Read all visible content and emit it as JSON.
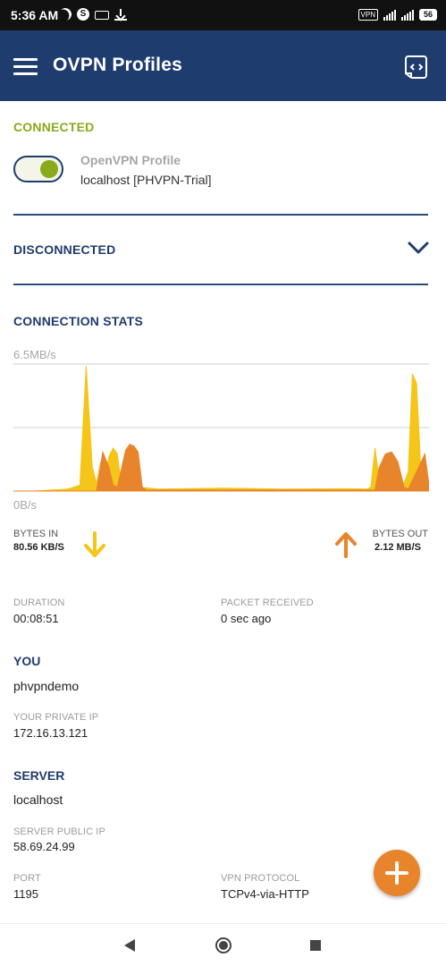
{
  "status_bar": {
    "time": "5:36 AM",
    "vpn_badge": "VPN",
    "network": "4G",
    "battery": "56"
  },
  "app_bar": {
    "title": "OVPN Profiles",
    "menu_icon": "hamburger-menu-icon",
    "action_icon": "import-profile-icon"
  },
  "connected_section": {
    "label": "CONNECTED",
    "profile_name": "OpenVPN Profile",
    "profile_host": "localhost [PHVPN-Trial]",
    "toggle_on": true
  },
  "disconnected_section": {
    "label": "DISCONNECTED"
  },
  "stats": {
    "label": "CONNECTION STATS",
    "bytes_in_label": "BYTES IN",
    "bytes_in_value": "80.56 KB/S",
    "bytes_out_label": "BYTES OUT",
    "bytes_out_value": "2.12 MB/S"
  },
  "chart_data": {
    "type": "area",
    "y_max_label": "6.5MB/s",
    "y_min_label": "0B/s",
    "ylim": [
      0,
      6.5
    ],
    "grid": true,
    "series": [
      {
        "color": "#f5c518",
        "x": [
          0,
          0.05,
          0.13,
          0.16,
          0.175,
          0.19,
          0.2,
          0.21,
          0.22,
          0.23,
          0.24,
          0.25,
          0.26,
          0.27,
          0.28,
          0.3,
          0.35,
          0.5,
          0.65,
          0.8,
          0.85,
          0.86,
          0.87,
          0.88,
          0.9,
          0.92,
          0.94,
          0.95,
          0.96,
          0.97,
          0.98,
          0.99,
          1.0
        ],
        "values": [
          0,
          0,
          0.1,
          0.3,
          6.4,
          1.2,
          0.4,
          1.5,
          0.6,
          1.8,
          2.2,
          1.9,
          0.3,
          0.15,
          0.15,
          0.2,
          0.1,
          0.15,
          0.1,
          0.12,
          0.1,
          0.2,
          2.2,
          0.6,
          0.3,
          0.2,
          0.4,
          1.0,
          6.0,
          5.5,
          1.2,
          0.3,
          0.1
        ]
      },
      {
        "color": "#e8842b",
        "x": [
          0,
          0.2,
          0.215,
          0.23,
          0.24,
          0.25,
          0.27,
          0.28,
          0.29,
          0.3,
          0.31,
          0.32,
          0.5,
          0.87,
          0.88,
          0.895,
          0.91,
          0.925,
          0.94,
          0.95,
          0.99,
          1.0
        ],
        "values": [
          0,
          0,
          2.0,
          1.2,
          0.3,
          0.2,
          2.1,
          2.4,
          2.3,
          2.0,
          0.2,
          0.05,
          0.05,
          0.05,
          1.2,
          1.9,
          2.0,
          1.5,
          0.2,
          0.1,
          1.9,
          0.3
        ]
      }
    ]
  },
  "details": {
    "duration_label": "DURATION",
    "duration_value": "00:08:51",
    "packet_label": "PACKET RECEIVED",
    "packet_value": "0 sec ago",
    "you_label": "YOU",
    "username": "phvpndemo",
    "private_ip_label": "YOUR PRIVATE IP",
    "private_ip": "172.16.13.121",
    "server_label": "SERVER",
    "server_name": "localhost",
    "public_ip_label": "SERVER PUBLIC IP",
    "public_ip": "58.69.24.99",
    "port_label": "PORT",
    "port_value": "1195",
    "protocol_label": "VPN PROTOCOL",
    "protocol_value": "TCPv4-via-HTTP"
  },
  "colors": {
    "primary": "#1f3c6e",
    "connected_green": "#8aaa1c",
    "accent_orange": "#e8842b",
    "accent_yellow": "#f5c518"
  }
}
